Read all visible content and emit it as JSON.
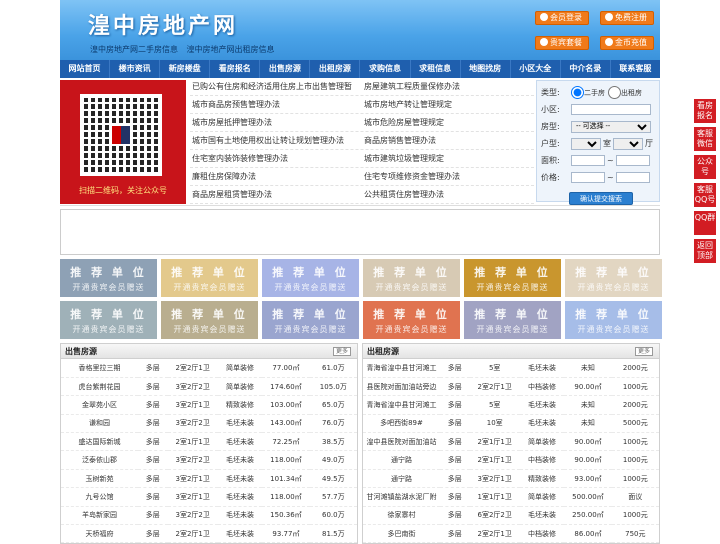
{
  "header": {
    "title": "湟中房地产网",
    "sub": [
      "湟中房地产网二手房信息",
      "湟中房地产网出租房信息"
    ],
    "buttons": [
      "会员登录",
      "免费注册",
      "贵宾套餐",
      "金币充值"
    ]
  },
  "nav": [
    "网站首页",
    "楼市资讯",
    "新房楼盘",
    "看房报名",
    "出售房源",
    "出租房源",
    "求购信息",
    "求租信息",
    "地图找房",
    "小区大全",
    "中介名录",
    "联系客服"
  ],
  "qr": {
    "caption": "扫描二维码，关注公众号"
  },
  "links": [
    [
      "已购公有住房和经济适用住房上市出售管理暂",
      "房屋建筑工程质量保修办法"
    ],
    [
      "城市商品房预售管理办法",
      "城市房地产转让管理规定"
    ],
    [
      "城市房屋抵押管理办法",
      "城市危险房屋管理规定"
    ],
    [
      "城市国有土地使用权出让转让规划管理办法",
      "商品房销售管理办法"
    ],
    [
      "住宅室内装饰装修管理办法",
      "城市建筑垃圾管理规定"
    ],
    [
      "廉租住房保障办法",
      "住宅专项维修资金管理办法"
    ],
    [
      "商品房屋租赁管理办法",
      "公共租赁住房管理办法"
    ]
  ],
  "search": {
    "type_label": "类型:",
    "type_options": [
      "二手房",
      "出租房"
    ],
    "district_label": "小区:",
    "house_label": "房型:",
    "house_select": "-- 可选择 --",
    "layout_label": "户型:",
    "room_unit": "室",
    "hall_unit": "厅",
    "area_label": "面积:",
    "price_label": "价格:",
    "range_sep": "~",
    "submit": "确认提交搜索"
  },
  "ads": {
    "line1": "推 荐 单 位",
    "line2": "开通贵宾会员赠送"
  },
  "ad_colors": [
    "#8ea1b5",
    "#e3c98c",
    "#a7b4e6",
    "#d7cab4",
    "#c9962e",
    "#e2d6c2",
    "#9fb1b8",
    "#b9ae8f",
    "#9aa5cf",
    "#e07350",
    "#a1a3c3",
    "#a6bde8"
  ],
  "sale": {
    "title": "出售房源",
    "more": "更多",
    "rows": [
      [
        "香格里拉三期",
        "多层",
        "2室2厅1卫",
        "简单装修",
        "77.00㎡",
        "61.0万"
      ],
      [
        "虎台紫荆花园",
        "多层",
        "3室2厅2卫",
        "简单装修",
        "174.60㎡",
        "105.0万"
      ],
      [
        "金翠苑小区",
        "多层",
        "3室2厅1卫",
        "精致装修",
        "103.00㎡",
        "65.0万"
      ],
      [
        "谦和园",
        "多层",
        "3室2厅2卫",
        "毛坯未装",
        "143.00㎡",
        "76.0万"
      ],
      [
        "盛达国际新城",
        "多层",
        "2室1厅1卫",
        "毛坯未装",
        "72.25㎡",
        "38.5万"
      ],
      [
        "泛泰依山郡",
        "多层",
        "3室2厅2卫",
        "毛坯未装",
        "118.00㎡",
        "49.0万"
      ],
      [
        "玉树新苑",
        "多层",
        "3室2厅1卫",
        "毛坯未装",
        "101.34㎡",
        "49.5万"
      ],
      [
        "九号公馆",
        "多层",
        "3室2厅1卫",
        "毛坯未装",
        "118.00㎡",
        "57.7万"
      ],
      [
        "羊岛新家园",
        "多层",
        "3室2厅2卫",
        "毛坯未装",
        "150.36㎡",
        "60.0万"
      ],
      [
        "天桥福府",
        "多层",
        "2室2厅1卫",
        "毛坯未装",
        "93.77㎡",
        "81.5万"
      ]
    ]
  },
  "rent": {
    "title": "出租房源",
    "more": "更多",
    "rows": [
      [
        "青海省湟中县甘河滩工",
        "多层",
        "5室",
        "毛坯未装",
        "未知",
        "2000元"
      ],
      [
        "县医院对面加油站旁边",
        "多层",
        "2室2厅1卫",
        "中档装修",
        "90.00㎡",
        "1000元"
      ],
      [
        "青海省湟中县甘河滩工",
        "多层",
        "5室",
        "毛坯未装",
        "未知",
        "2000元"
      ],
      [
        "多吧西街89#",
        "多层",
        "10室",
        "毛坯未装",
        "未知",
        "5000元"
      ],
      [
        "湟中县医院对面加油站",
        "多层",
        "2室1厅1卫",
        "简单装修",
        "90.00㎡",
        "1000元"
      ],
      [
        "通宁路",
        "多层",
        "2室1厅1卫",
        "中档装修",
        "90.00㎡",
        "1000元"
      ],
      [
        "通宁路",
        "多层",
        "3室2厅1卫",
        "精致装修",
        "93.00㎡",
        "1000元"
      ],
      [
        "甘河滩镇盐湖水泥厂附",
        "多层",
        "1室1厅1卫",
        "简单装修",
        "500.00㎡",
        "面议"
      ],
      [
        "徐家寨村",
        "多层",
        "6室2厅2卫",
        "毛坯未装",
        "250.00㎡",
        "1000元"
      ],
      [
        "多巴南街",
        "多层",
        "2室2厅1卫",
        "中档装修",
        "86.00㎡",
        "750元"
      ]
    ]
  },
  "side": [
    "看房报名",
    "客服微信",
    "公众号",
    "客服QQ号",
    "QQ群",
    "返回顶部"
  ]
}
